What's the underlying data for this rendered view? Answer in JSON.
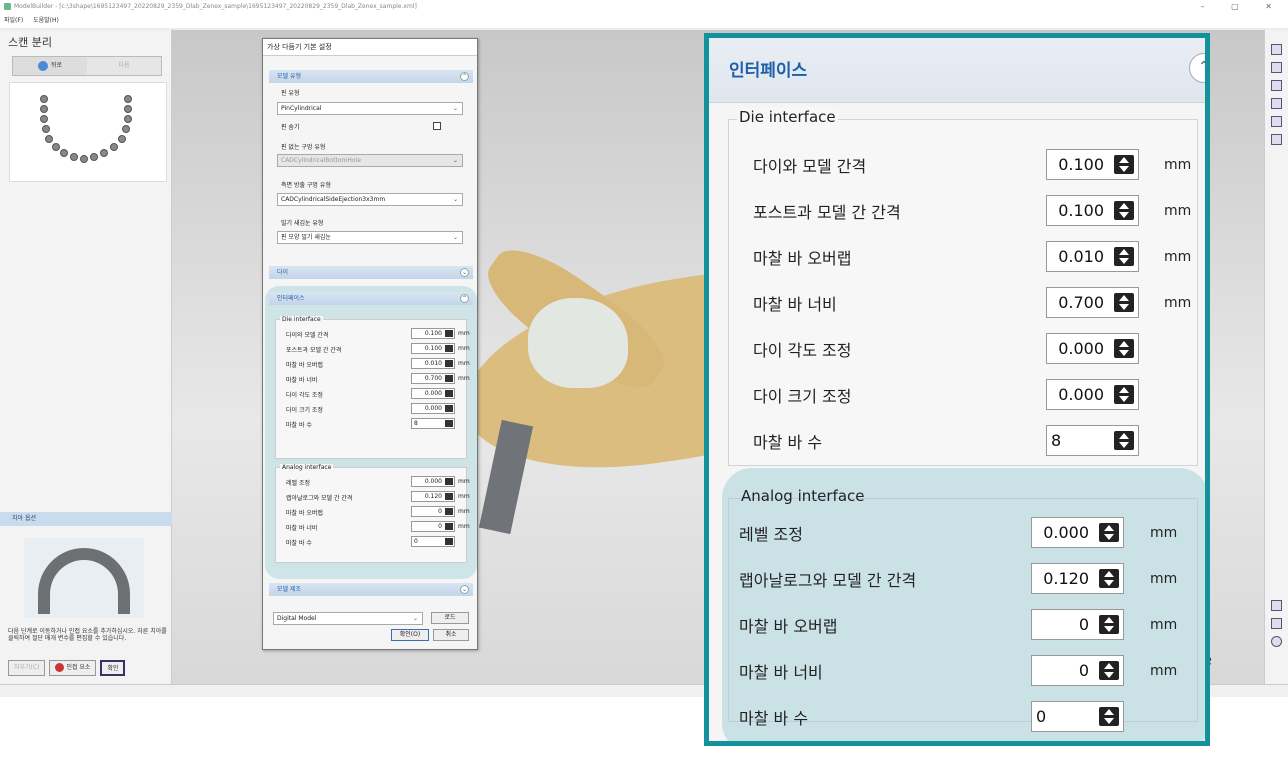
{
  "window": {
    "title": "ModelBuilder - [c:\\3shape\\1695123497_20220829_2359_Dlab_Zenex_sample\\1695123497_20220829_2359_Dlab_Zenex_sample.xml]",
    "controls": "– ▢ ✕"
  },
  "menu": {
    "file": "파일(F)",
    "help": "도움말(H)"
  },
  "left_panel": {
    "title": "스캔 분리",
    "back_label": "뒤로",
    "next_label": "다음",
    "tooth_options": "치아 옵션",
    "help_text": "다음 단계로 이동하거나 인접 요소를 추가하십시오. 자른 치아를 클릭하여 절단 매개 변수를 편집할 수 있습니다.",
    "remove_label": "지우기(C)",
    "add_adjacent_label": "인접 요소",
    "confirm_label": "확인"
  },
  "dialog": {
    "title": "가상 다듬기 기본 설정",
    "model_type": {
      "header": "모델 유형",
      "pin_type_label": "핀 유형",
      "pin_type_value": "PinCylindrical",
      "pin_hide_label": "핀 숨기",
      "no_pin_hole_label": "핀 없는 구멍 유형",
      "no_pin_hole_value": "CADCylindricalBottomHole",
      "side_eject_label": "측면 방출 구멍 유형",
      "side_eject_value": "CADCylindricalSideEjection3x3mm",
      "engraving_label": "밀기 새김눈 유형",
      "engraving_value": "핀 모양 밀기 새김눈"
    },
    "die_header": "다이",
    "interface_header": "인터페이스",
    "model_make_header": "모델 제조",
    "model_combo_value": "Digital Model",
    "load_label": "로드",
    "ok_label": "확인(O)",
    "cancel_label": "취소"
  },
  "interface": {
    "title": "인터페이스",
    "die_group": "Die interface",
    "die_rows": [
      {
        "label": "다이와 모델 간격",
        "value": "0.100",
        "unit": "mm"
      },
      {
        "label": "포스트과 모델 간 간격",
        "value": "0.100",
        "unit": "mm"
      },
      {
        "label": "마찰 바 오버랩",
        "value": "0.010",
        "unit": "mm"
      },
      {
        "label": "마찰 바 너비",
        "value": "0.700",
        "unit": "mm"
      },
      {
        "label": "다이 각도 조정",
        "value": "0.000",
        "unit": ""
      },
      {
        "label": "다이 크기 조정",
        "value": "0.000",
        "unit": ""
      },
      {
        "label": "마찰 바 수",
        "value": "8",
        "unit": ""
      }
    ],
    "analog_group": "Analog interface",
    "analog_rows": [
      {
        "label": "레벨 조정",
        "value": "0.000",
        "unit": "mm"
      },
      {
        "label": "랩아날로그와 모델 간 간격",
        "value": "0.120",
        "unit": "mm"
      },
      {
        "label": "마찰 바 오버랩",
        "value": "0",
        "unit": "mm"
      },
      {
        "label": "마찰 바 너비",
        "value": "0",
        "unit": "mm"
      },
      {
        "label": "마찰 바 수",
        "value": "0",
        "unit": ""
      }
    ]
  },
  "viewport": {
    "logo_text": "pe"
  },
  "colors": {
    "accent": "#1d5fa8",
    "frame": "#14929c",
    "highlight": "#a0d0d7"
  }
}
